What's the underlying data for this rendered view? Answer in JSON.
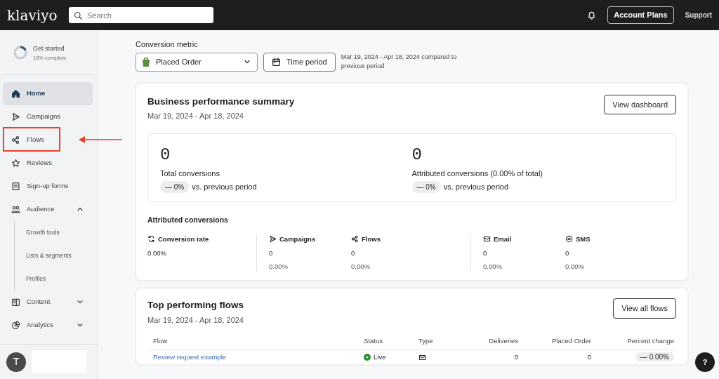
{
  "topbar": {
    "logo": "klaviyo",
    "search": {
      "placeholder": "Search"
    },
    "account_button": "Account Plans",
    "support": "Support"
  },
  "sidebar": {
    "get_started": {
      "title": "Get started",
      "subtitle": "18% complete",
      "level": 0.18
    },
    "items": [
      {
        "label": "Home",
        "selected": true,
        "highlighted": false
      },
      {
        "label": "Campaigns",
        "selected": false,
        "highlighted": false
      },
      {
        "label": "Flows",
        "selected": false,
        "highlighted": true
      },
      {
        "label": "Reviews",
        "selected": false,
        "highlighted": false
      },
      {
        "label": "Sign-up forms",
        "selected": false,
        "highlighted": false
      },
      {
        "label": "Audience",
        "selected": false,
        "highlighted": false,
        "expanded": true,
        "children": [
          {
            "label": "Growth tools"
          },
          {
            "label": "Lists & segments"
          },
          {
            "label": "Profiles"
          }
        ]
      },
      {
        "label": "Content",
        "selected": false,
        "highlighted": false,
        "expanded": false
      },
      {
        "label": "Analytics",
        "selected": false,
        "highlighted": false,
        "expanded": false
      }
    ],
    "avatar": "T"
  },
  "filters": {
    "label": "Conversion metric",
    "metric": "Placed Order",
    "time_button": "Time period",
    "range_note": "Mar 19, 2024 - Apr 18, 2024 compared to previous period"
  },
  "summary": {
    "title": "Business performance summary",
    "dates": "Mar 19, 2024 - Apr 18, 2024",
    "button": "View dashboard",
    "stats": [
      {
        "value": "0",
        "label": "Total conversions",
        "change": "— 0%",
        "compare": "vs. previous period"
      },
      {
        "value": "0",
        "label": "Attributed conversions (0.00% of total)",
        "change": "— 0%",
        "compare": "vs. previous period"
      }
    ],
    "attributed_title": "Attributed conversions",
    "metrics": [
      {
        "label": "Conversion rate",
        "value": "0.00%"
      },
      {
        "label": "Campaigns",
        "value": "0",
        "percent": "0.00%"
      },
      {
        "label": "Flows",
        "value": "0",
        "percent": "0.00%"
      },
      {
        "label": "Email",
        "value": "0",
        "percent": "0.00%"
      },
      {
        "label": "SMS",
        "value": "0",
        "percent": "0.00%"
      }
    ]
  },
  "flows": {
    "title": "Top performing flows",
    "dates": "Mar 19, 2024 - Apr 18, 2024",
    "button": "View all flows",
    "columns": [
      "Flow",
      "Status",
      "Type",
      "Deliveries",
      "Placed Order",
      "Percent change"
    ],
    "rows": [
      {
        "name": "Review request example",
        "status": "Live",
        "deliveries": "0",
        "placed_order": "0",
        "change": "— 0.00%"
      }
    ]
  },
  "help_button": "?"
}
